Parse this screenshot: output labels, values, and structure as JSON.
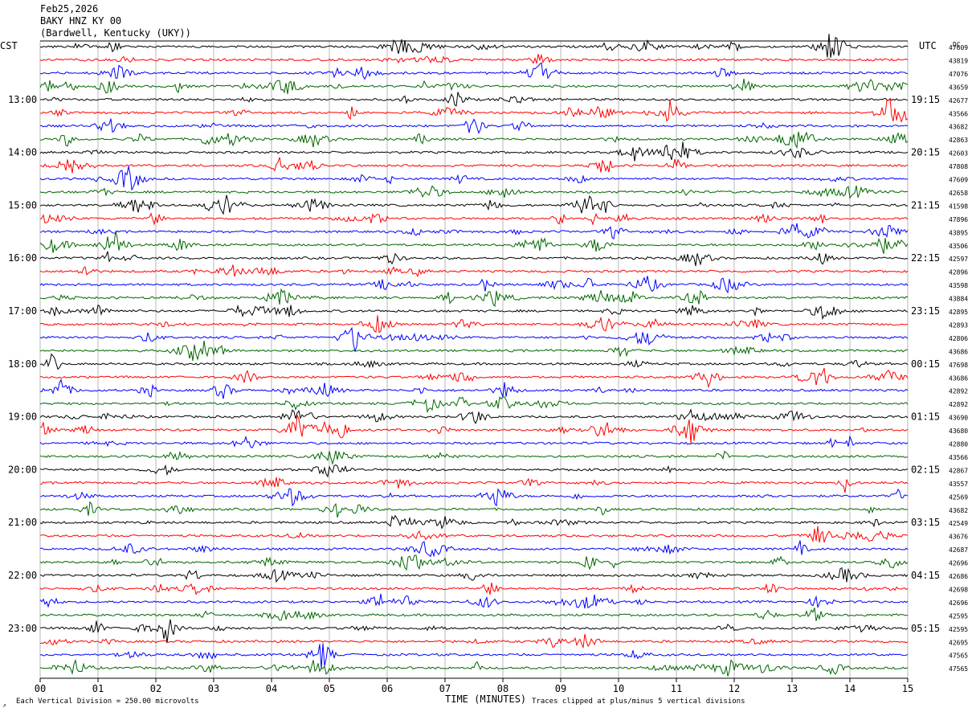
{
  "header": {
    "date": "Feb25,2026",
    "station": "BAKY HNZ KY 00",
    "location": "(Bardwell, Kentucky (UKY))"
  },
  "left_timezone": "CST",
  "right_timezone": "UTC",
  "dc_label": "DC",
  "footer": {
    "scale_note": "Each Vertical Division =  250.00 microvolts",
    "clip_note": "Traces clipped at plus/minus 5 vertical divisions",
    "xlabel": "TIME (MINUTES)"
  },
  "colors": {
    "cycle": [
      "#000000",
      "#ff0000",
      "#0000ff",
      "#006600"
    ],
    "grid": "#888888"
  },
  "chart_data": {
    "type": "line",
    "xlabel": "TIME (MINUTES)",
    "xlim": [
      0,
      15
    ],
    "x_ticks": [
      "00",
      "01",
      "02",
      "03",
      "04",
      "05",
      "06",
      "07",
      "08",
      "09",
      "10",
      "11",
      "12",
      "13",
      "14",
      "15"
    ],
    "left_time_labels": [
      "13:00",
      "14:00",
      "15:00",
      "16:00",
      "17:00",
      "18:00",
      "19:00",
      "20:00",
      "21:00",
      "22:00",
      "23:00"
    ],
    "right_time_labels": [
      "19:15",
      "20:15",
      "21:15",
      "22:15",
      "23:15",
      "00:15",
      "01:15",
      "02:15",
      "03:15",
      "04:15",
      "05:15"
    ],
    "trace_minutes_per_line": 15,
    "dc_offsets": [
      "47609",
      "43819",
      "47076",
      "43659",
      "42677",
      "43566",
      "43682",
      "42863",
      "42603",
      "47808",
      "47609",
      "42658",
      "41598",
      "47896",
      "43895",
      "43506",
      "42597",
      "42896",
      "43598",
      "43884",
      "42895",
      "42893",
      "42806",
      "43686",
      "47698",
      "43686",
      "42892",
      "42892",
      "43690",
      "43680",
      "42880",
      "43566",
      "42867",
      "43557",
      "42569",
      "43682",
      "42549",
      "43676",
      "42687",
      "42696",
      "42686",
      "42698",
      "42696",
      "42595",
      "42595",
      "42695",
      "47565",
      "47565"
    ]
  }
}
